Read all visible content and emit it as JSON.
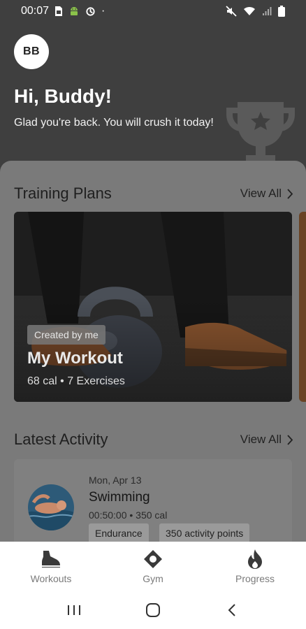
{
  "status_bar": {
    "time": "00:07",
    "dot": "·",
    "left_icons": [
      "sim-card-icon",
      "android-icon",
      "sync-icon"
    ],
    "right_icons": [
      "mute-icon",
      "wifi-icon",
      "signal-icon",
      "battery-icon"
    ]
  },
  "header": {
    "avatar_initials": "BB",
    "greeting": "Hi, Buddy!",
    "subtitle": "Glad you're back. You will crush it today!",
    "decoration_icon": "trophy-icon"
  },
  "training_plans": {
    "title": "Training Plans",
    "view_all": "View All",
    "card": {
      "badge": "Created by me",
      "title": "My Workout",
      "meta": "68 cal • 7 Exercises"
    }
  },
  "latest_activity": {
    "title": "Latest Activity",
    "view_all": "View All",
    "item": {
      "date": "Mon, Apr 13",
      "name": "Swimming",
      "stats": "00:50:00 • 350 cal",
      "tags": [
        "Endurance",
        "350 activity points"
      ]
    }
  },
  "bottom_nav": {
    "items": [
      {
        "label": "Workouts",
        "icon": "shoe-icon"
      },
      {
        "label": "Gym",
        "icon": "location-pin-icon"
      },
      {
        "label": "Progress",
        "icon": "flame-icon"
      }
    ]
  },
  "system_nav": {
    "buttons": [
      "recent-apps-icon",
      "home-icon",
      "back-icon"
    ]
  },
  "colors": {
    "header_bg": "#3f3f3f",
    "sheet_bg": "#7a7a7a",
    "nav_bg": "#ffffff",
    "nav_text": "#7a7a7a"
  }
}
